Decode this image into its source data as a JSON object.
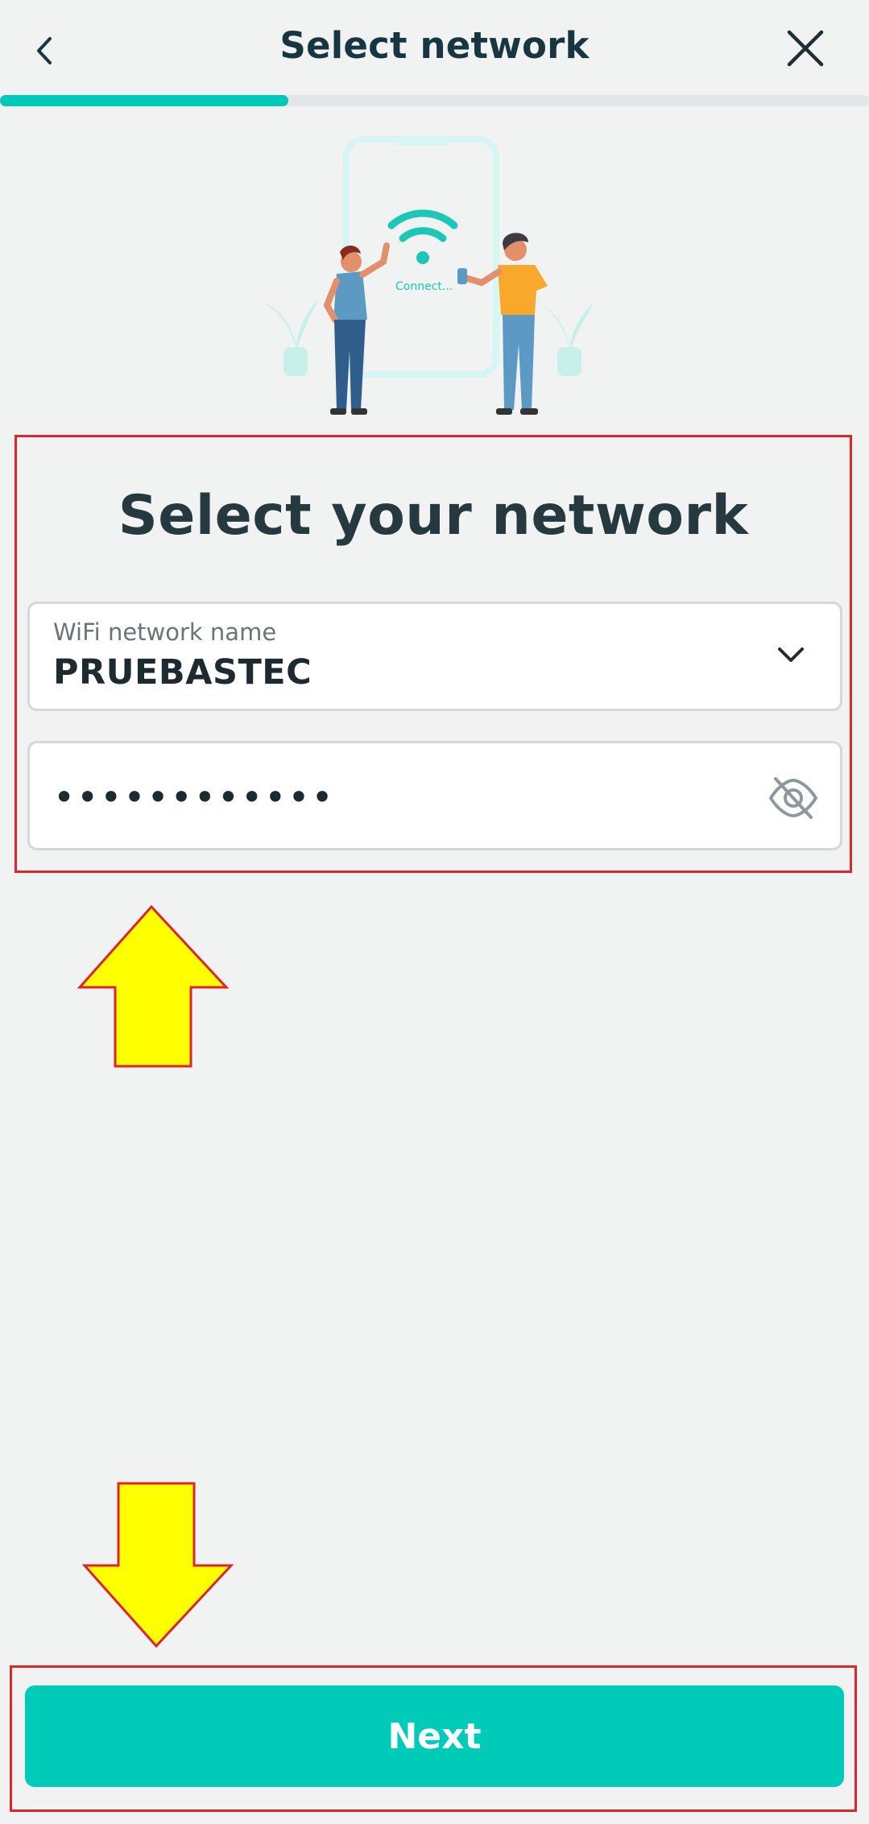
{
  "header": {
    "title": "Select network",
    "back_icon": "chevron-left-icon",
    "close_icon": "close-icon"
  },
  "progress": {
    "steps_total": 5,
    "current_step": 1,
    "active_color": "#00c9b7"
  },
  "illustration": {
    "caption": "Connect..."
  },
  "form": {
    "heading": "Select your network",
    "ssid": {
      "label": "WiFi network name",
      "value": "PRUEBASTEC",
      "icon": "chevron-down-icon"
    },
    "password": {
      "masked_value": "••••••••••••",
      "icon": "eye-off-icon"
    }
  },
  "annotations": {
    "arrow_color": "#ffff00",
    "outline_color": "#e0242b"
  },
  "footer": {
    "next_label": "Next",
    "next_color": "#00cbb9"
  }
}
